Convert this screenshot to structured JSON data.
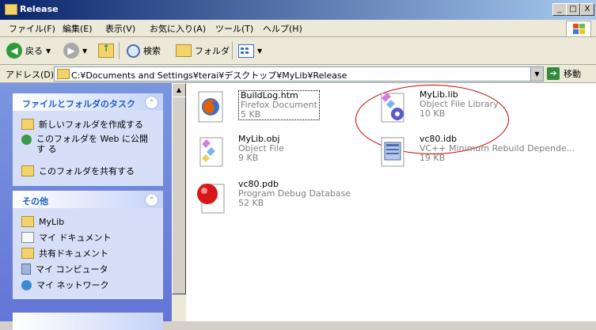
{
  "window": {
    "title": "Release",
    "minimize": "_",
    "maximize": "□",
    "close": "X"
  },
  "menubar": [
    "ファイル(F)",
    "編集(E)",
    "表示(V)",
    "お気に入り(A)",
    "ツール(T)",
    "ヘルプ(H)"
  ],
  "toolbar": {
    "back_label": "戻る",
    "search_label": "検索",
    "folders_label": "フォルダ"
  },
  "address": {
    "label": "アドレス(D)",
    "value": "C:¥Documents and Settings¥terai¥デスクトップ¥MyLib¥Release",
    "go_label": "移動"
  },
  "tasks_panel": {
    "title": "ファイルとフォルダのタスク",
    "items": [
      "新しいフォルダを作成する",
      "このフォルダを Web に公開す る",
      "このフォルダを共有する"
    ]
  },
  "other_panel": {
    "title": "その他",
    "items": [
      "MyLib",
      "マイ ドキュメント",
      "共有ドキュメント",
      "マイ コンピュータ",
      "マイ ネットワーク"
    ]
  },
  "files": [
    {
      "name": "BuildLog.htm",
      "type": "Firefox Document",
      "size": "5 KB",
      "icon": "firefox-icon"
    },
    {
      "name": "MyLib.lib",
      "type": "Object File Library",
      "size": "10 KB",
      "icon": "library-icon"
    },
    {
      "name": "MyLib.obj",
      "type": "Object File",
      "size": "9 KB",
      "icon": "object-file-icon"
    },
    {
      "name": "vc80.idb",
      "type": "VC++ Minimum Rebuild Depende...",
      "size": "19 KB",
      "icon": "idb-icon"
    },
    {
      "name": "vc80.pdb",
      "type": "Program Debug Database",
      "size": "52 KB",
      "icon": "pdb-icon"
    }
  ],
  "colors": {
    "titlebar_start": "#0a246a",
    "titlebar_end": "#a6caf0",
    "task_pane": "#6375d6",
    "annotation_oval": "#d00000"
  }
}
